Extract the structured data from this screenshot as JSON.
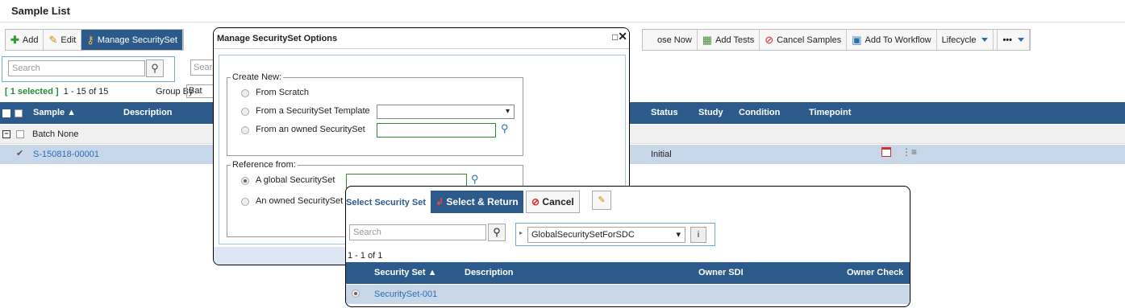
{
  "page": {
    "title": "Sample List"
  },
  "toolbar": {
    "add": "Add",
    "edit": "Edit",
    "manage": "Manage SecuritySet",
    "dispose": "ose Now",
    "add_tests": "Add Tests",
    "cancel_samples": "Cancel Samples",
    "add_to_workflow": "Add To Workflow",
    "lifecycle": "Lifecycle",
    "more": "•••"
  },
  "search": {
    "placeholder": "Search",
    "placeholder2": "Sear"
  },
  "list": {
    "selected": "[ 1 selected ]",
    "range": "1 - 15 of 15",
    "group_by_label": "Group By",
    "group_by_value": "Bat",
    "columns": {
      "sample": "Sample ▲",
      "description": "Description",
      "status": "Status",
      "study": "Study",
      "condition": "Condition",
      "timepoint": "Timepoint"
    },
    "group": "Batch None",
    "rows": [
      {
        "sample": "S-150818-00001",
        "status": "Initial"
      }
    ]
  },
  "dialog": {
    "title": "Manage SecuritySet Options",
    "create_legend": "Create New:",
    "from_scratch": "From Scratch",
    "from_template": "From a SecuritySet Template",
    "from_owned": "From an owned SecuritySet",
    "ref_legend": "Reference from:",
    "global": "A global SecuritySet",
    "owned": "An owned SecuritySet"
  },
  "panel": {
    "title": "Select Security Set",
    "select_return": "Select & Return",
    "cancel": "Cancel",
    "search_placeholder": "Search",
    "filter_value": "GlobalSecuritySetForSDC",
    "info": "i",
    "range": "1 - 1 of 1",
    "columns": {
      "security_set": "Security Set ▲",
      "description": "Description",
      "owner_sdi": "Owner SDI",
      "owner_check": "Owner Check"
    },
    "rows": [
      {
        "security_set": "SecuritySet-001"
      }
    ]
  },
  "colors": {
    "header": "#2c5b8b",
    "selected_row": "#c7d7e8",
    "link": "#2a6db5",
    "green": "#1f8f35"
  }
}
